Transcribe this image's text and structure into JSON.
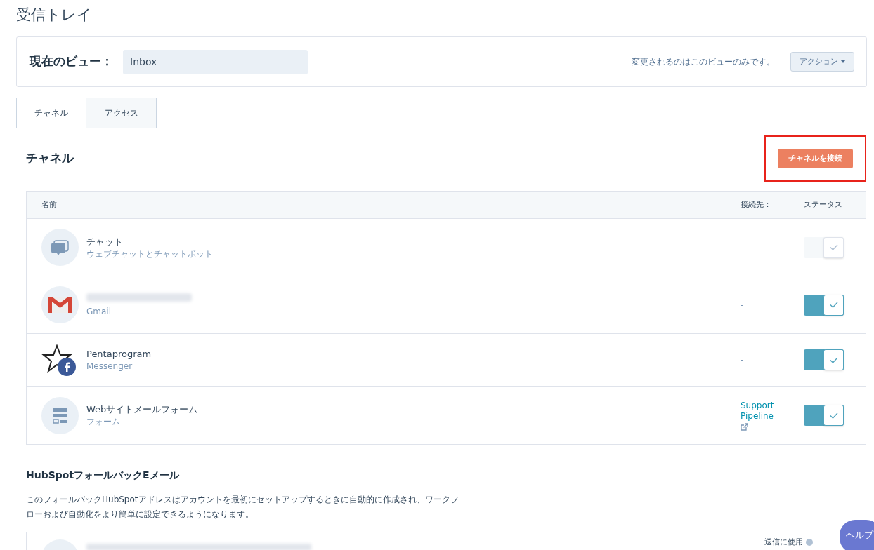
{
  "page_title": "受信トレイ",
  "view_bar": {
    "label": "現在のビュー：",
    "view_name": "Inbox",
    "note": "変更されるのはこのビューのみです。",
    "action_button": "アクション"
  },
  "tabs": [
    {
      "label": "チャネル",
      "selected": true
    },
    {
      "label": "アクセス",
      "selected": false
    }
  ],
  "channels_section": {
    "heading": "チャネル",
    "connect_button": "チャネルを接続",
    "connect_button_highlighted": true
  },
  "table": {
    "columns": [
      "名前",
      "接続先：",
      "ステータス"
    ],
    "rows": [
      {
        "kind": "chat",
        "name": "チャット",
        "subtitle": "ウェブチャットとチャットボット",
        "destination": "-",
        "on": true,
        "disabled": true
      },
      {
        "kind": "gmail",
        "subtitle": "Gmail",
        "destination": "-",
        "on": true,
        "disabled": false
      },
      {
        "kind": "messenger",
        "name": "Pentaprogram",
        "subtitle": "Messenger",
        "destination": "-",
        "on": true,
        "disabled": false
      },
      {
        "kind": "form",
        "name": "Webサイトメールフォーム",
        "subtitle": "フォーム",
        "destination_link": "Support Pipeline",
        "on": true,
        "disabled": false
      }
    ]
  },
  "fallback": {
    "heading": "HubSpotフォールバックEメール",
    "description": "このフォールバックHubSpotアドレスはアカウントを最初にセットアップするときに自動的に作成され、ワークフローおよび自動化をより簡単に設定できるようになります。",
    "row_label": "送信に使用"
  },
  "help_button": "ヘルプ"
}
